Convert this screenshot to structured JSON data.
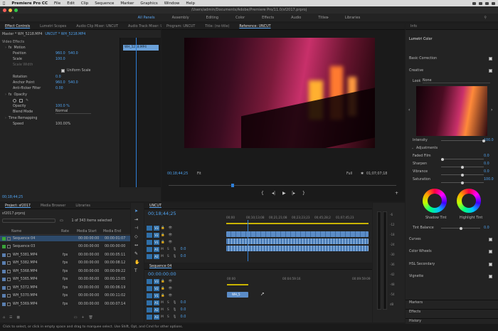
{
  "menubar": {
    "app": "Premiere Pro CC",
    "items": [
      "File",
      "Edit",
      "Clip",
      "Sequence",
      "Marker",
      "Graphics",
      "Window",
      "Help"
    ]
  },
  "titlebar": {
    "path": "/Users/admin/Documents/Adobe/Premiere Pro/11.0/sf2017.prproj"
  },
  "workspaces": {
    "items": [
      "All Panels",
      "Assembly",
      "Editing",
      "Color",
      "Effects",
      "Audio",
      "Titles",
      "Libraries"
    ],
    "active": "All Panels",
    "more": "»"
  },
  "effect_controls": {
    "tabs": [
      "Effect Controls",
      "Lumetri Scopes",
      "Audio Clip Mixer: UNCUT",
      "Audio Track Mixer: UNI"
    ],
    "source_label": "Master * WH_5218.MP4",
    "clip_label": "UNCUT * WH_5218.MP4",
    "mini_clip": "WH_5218.MP4",
    "section_video": "Video Effects",
    "motion": "Motion",
    "position_label": "Position",
    "position_x": "960.0",
    "position_y": "540.0",
    "scale_label": "Scale",
    "scale_value": "100.0",
    "scale_width_label": "Scale Width",
    "uniform_scale": "Uniform Scale",
    "rotation_label": "Rotation",
    "rotation_value": "0.0",
    "anchor_label": "Anchor Point",
    "anchor_x": "960.0",
    "anchor_y": "540.0",
    "antiflicker_label": "Anti-flicker Filter",
    "antiflicker_value": "0.00",
    "opacity": "Opacity",
    "opacity_label": "Opacity",
    "opacity_value": "100.0 %",
    "blend_label": "Blend Mode",
    "blend_value": "Normal",
    "time_remap": "Time Remapping",
    "speed_label": "Speed",
    "speed_value": "100.00%",
    "timecode": "00;18;44;25"
  },
  "program": {
    "tabs": [
      "Program: UNCUT",
      "Title: (no title)",
      "Reference: UNCUT"
    ],
    "timecode_left": "00;18;44;25",
    "fit": "Fit",
    "full": "Full",
    "timecode_right": "01;07;07;18"
  },
  "project": {
    "tabs": [
      "Project: sf2017",
      "Media Browser",
      "Libraries"
    ],
    "filename": "sf2017.prproj",
    "count": "1 of 343 items selected",
    "columns": [
      "Name",
      "Rate",
      "Media Start",
      "Media End"
    ],
    "rows": [
      {
        "name": "Sequence 04",
        "rate": "",
        "start": "00:00:00:00",
        "end": "00:00:01:07",
        "color": "#3aa33a"
      },
      {
        "name": "Sequence 03",
        "rate": "",
        "start": "00:00:00:00",
        "end": "00:00:00:00",
        "color": "#3aa33a"
      },
      {
        "name": "WH_5381.MP4",
        "rate": "fps",
        "start": "00:00:00:00",
        "end": "00:00:05:11",
        "color": "#5a7fb0"
      },
      {
        "name": "WH_5382.MP4",
        "rate": "fps",
        "start": "00:00:00:00",
        "end": "00:00:08:12",
        "color": "#5a7fb0"
      },
      {
        "name": "WH_5368.MP4",
        "rate": "fps",
        "start": "00:00:00:00",
        "end": "00:00:09:22",
        "color": "#5a7fb0"
      },
      {
        "name": "WH_5365.MP4",
        "rate": "fps",
        "start": "00:00:00:00",
        "end": "00:00:13:05",
        "color": "#5a7fb0"
      },
      {
        "name": "WH_5372.MP4",
        "rate": "fps",
        "start": "00:00:00:00",
        "end": "00:00:06:19",
        "color": "#5a7fb0"
      },
      {
        "name": "WH_5370.MP4",
        "rate": "fps",
        "start": "00:00:00:00",
        "end": "00:00:11:02",
        "color": "#5a7fb0"
      },
      {
        "name": "WH_5369.MP4",
        "rate": "fps",
        "start": "00:00:00:00",
        "end": "00:00:07:14",
        "color": "#5a7fb0"
      }
    ]
  },
  "timeline_top": {
    "tab": "UNCUT",
    "timecode": "00;18;44;25",
    "ruler": [
      "00;00",
      "00;10;13;08",
      "00;21;21;08",
      "00;23;23;23",
      "00;45;28;2",
      "00;00;00",
      "01;07;45;23"
    ],
    "tracks": [
      "V3",
      "V2",
      "V1",
      "A1",
      "A2"
    ],
    "audio_value": "0.0"
  },
  "timeline_bottom": {
    "tab": "Sequence 04",
    "timecode": "00:00:00:00",
    "ruler": [
      "00:00",
      "00:04:59:16",
      "00:09:59:09"
    ],
    "tracks": [
      "V3",
      "V2",
      "V1",
      "A1",
      "A2",
      "A3"
    ],
    "clip_label": "WH_5",
    "audio_value": "0.0"
  },
  "info": {
    "tab": "Info"
  },
  "lumetri": {
    "tab": "Lumetri Color",
    "basic": "Basic Correction",
    "creative": "Creative",
    "look_label": "Look",
    "look_value": "None",
    "intensity_label": "Intensity",
    "intensity_value": "100.0",
    "adjustments": "Adjustments",
    "faded_label": "Faded Film",
    "faded_value": "0.0",
    "sharpen_label": "Sharpen",
    "sharpen_value": "0.0",
    "vibrance_label": "Vibrance",
    "vibrance_value": "0.0",
    "saturation_label": "Saturation",
    "saturation_value": "100.0",
    "shadow_tint": "Shadow Tint",
    "highlight_tint": "Highlight Tint",
    "tint_balance_label": "Tint Balance",
    "tint_balance_value": "0.0",
    "curves": "Curves",
    "color_wheels": "Color Wheels",
    "hsl": "HSL Secondary",
    "vignette": "Vignette",
    "markers": "Markers",
    "effects": "Effects",
    "history": "History"
  },
  "statusbar": {
    "text": "Click to select, or click in empty space and drag to marquee select. Use Shift, Opt, and Cmd for other options."
  },
  "meter": {
    "labels": [
      "-6",
      "-12",
      "-18",
      "-24",
      "-30",
      "-36",
      "-42",
      "-48",
      "-54",
      "dB"
    ]
  },
  "colors": {
    "accent": "#4ea1ee",
    "clip_video": "#5b8cc7",
    "clip_audio": "#4e7fb8",
    "playhead": "#2f7fd8"
  }
}
